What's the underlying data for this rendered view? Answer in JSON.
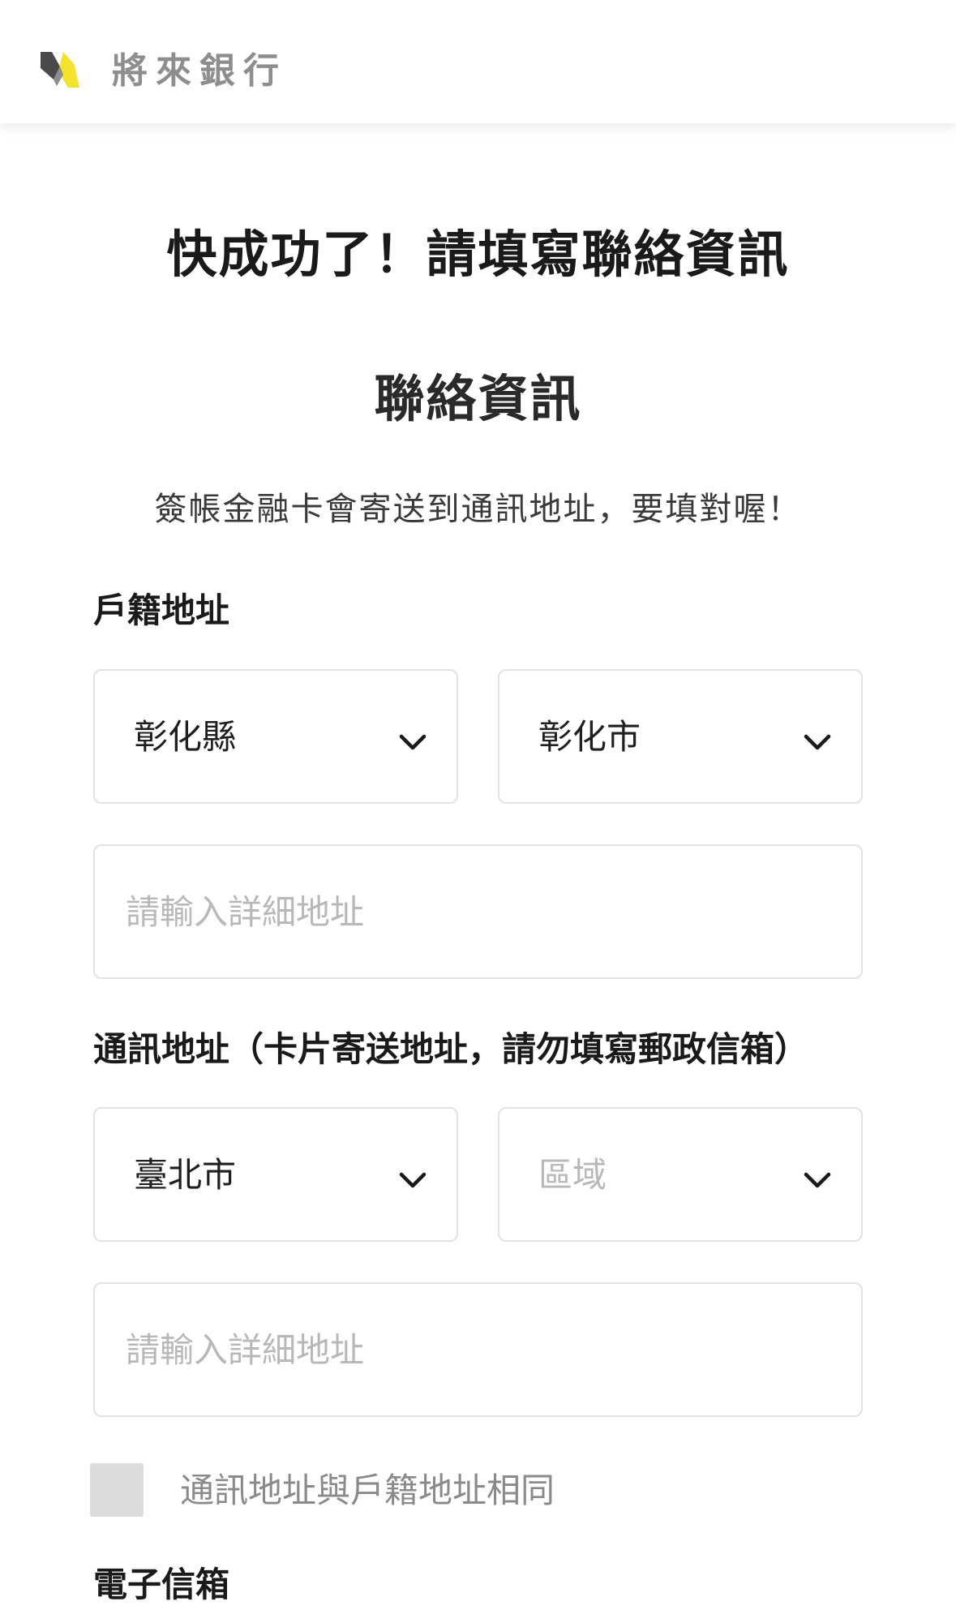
{
  "header": {
    "brand_name": "將來銀行",
    "logo_icon": "bank-logo-icon",
    "brand_colors": {
      "dark": "#4a4a4a",
      "accent": "#f5e32b"
    }
  },
  "page": {
    "title": "快成功了！請填寫聯絡資訊",
    "section_title": "聯絡資訊",
    "subtitle": "簽帳金融卡會寄送到通訊地址，要填對喔！"
  },
  "household_address": {
    "label": "戶籍地址",
    "county_select": {
      "value": "彰化縣",
      "icon": "chevron-down-icon"
    },
    "district_select": {
      "value": "彰化市",
      "icon": "chevron-down-icon"
    },
    "detail_input": {
      "value": "",
      "placeholder": "請輸入詳細地址"
    }
  },
  "mailing_address": {
    "label": "通訊地址（卡片寄送地址，請勿填寫郵政信箱）",
    "county_select": {
      "value": "臺北市",
      "icon": "chevron-down-icon"
    },
    "district_select": {
      "value": "",
      "placeholder": "區域",
      "icon": "chevron-down-icon"
    },
    "detail_input": {
      "value": "",
      "placeholder": "請輸入詳細地址"
    }
  },
  "same_address_checkbox": {
    "checked": false,
    "label": "通訊地址與戶籍地址相同"
  },
  "email": {
    "label": "電子信箱"
  }
}
